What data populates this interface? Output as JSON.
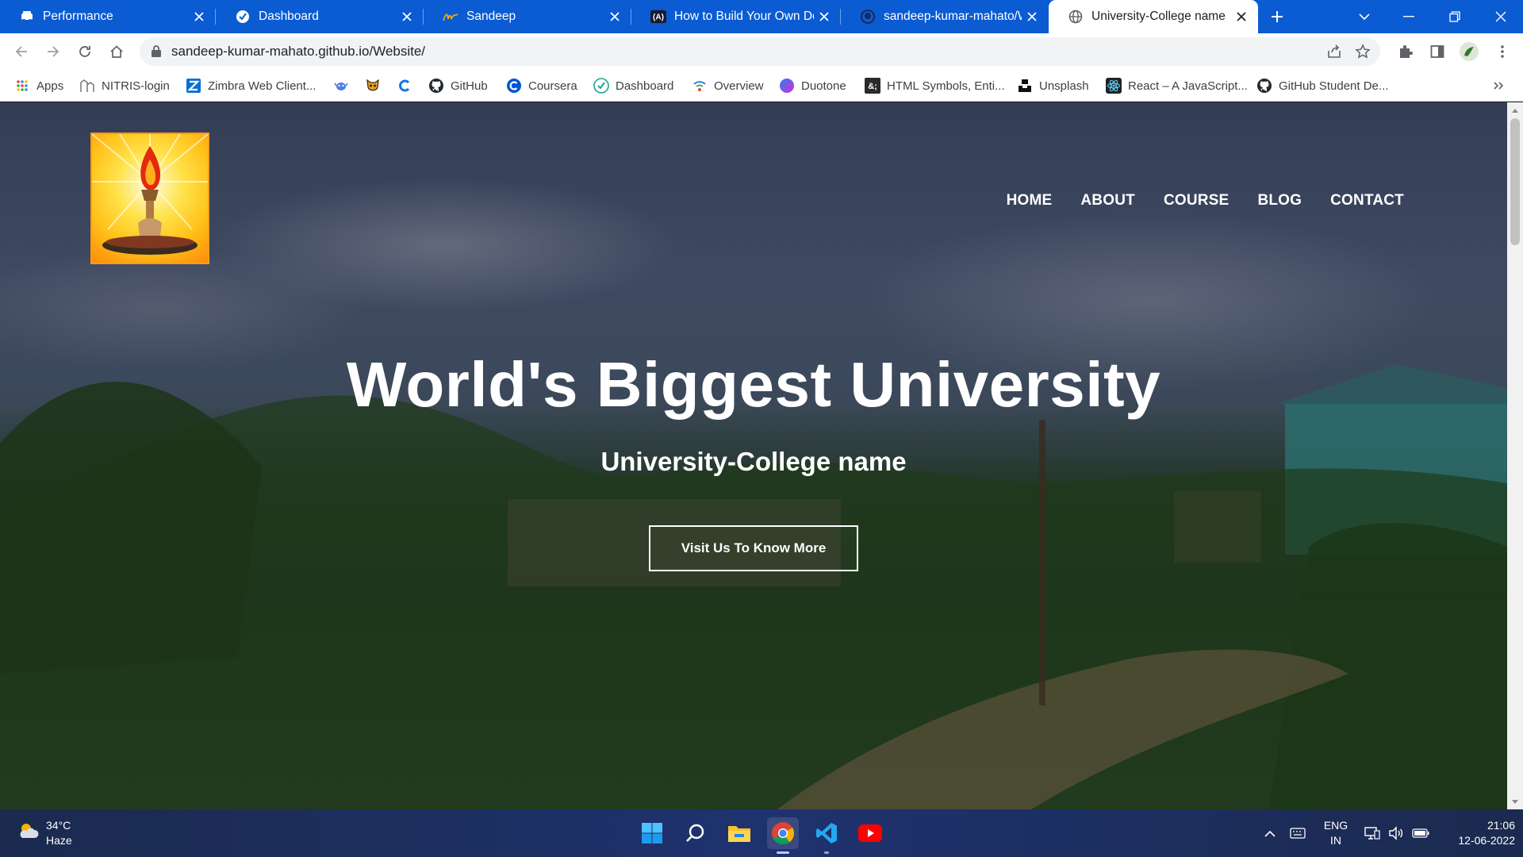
{
  "browser": {
    "tabs": [
      {
        "title": "Performance",
        "icon": "taxi-icon",
        "active": false
      },
      {
        "title": "Dashboard",
        "icon": "netlify-icon",
        "active": false
      },
      {
        "title": "Sandeep",
        "icon": "signature-icon",
        "active": false
      },
      {
        "title": "How to Build Your Own Dev",
        "icon": "a-icon",
        "active": false
      },
      {
        "title": "sandeep-kumar-mahato/W",
        "icon": "github-icon",
        "active": false
      },
      {
        "title": "University-College name",
        "icon": "globe-icon",
        "active": true
      }
    ],
    "url": "sandeep-kumar-mahato.github.io/Website/",
    "bookmarks": [
      {
        "label": "Apps",
        "icon": "apps-grid-icon"
      },
      {
        "label": "NITRIS-login",
        "icon": "nitris-icon"
      },
      {
        "label": "Zimbra Web Client...",
        "icon": "zimbra-icon"
      },
      {
        "label": "",
        "icon": "crab-icon"
      },
      {
        "label": "",
        "icon": "mask-icon"
      },
      {
        "label": "",
        "icon": "codechef-icon"
      },
      {
        "label": "GitHub",
        "icon": "github-icon"
      },
      {
        "label": "Coursera",
        "icon": "coursera-icon"
      },
      {
        "label": "Dashboard",
        "icon": "netlify-icon"
      },
      {
        "label": "Overview",
        "icon": "overview-icon"
      },
      {
        "label": "Duotone",
        "icon": "duotone-icon"
      },
      {
        "label": "HTML Symbols, Enti...",
        "icon": "html-symbols-icon"
      },
      {
        "label": "Unsplash",
        "icon": "unsplash-icon"
      },
      {
        "label": "React – A JavaScript...",
        "icon": "react-icon"
      },
      {
        "label": "GitHub Student De...",
        "icon": "github-icon"
      }
    ]
  },
  "page": {
    "nav": [
      "HOME",
      "ABOUT",
      "COURSE",
      "BLOG",
      "CONTACT"
    ],
    "hero_title": "World's Biggest University",
    "hero_subtitle": "University-College name",
    "cta_label": "Visit Us To Know More"
  },
  "taskbar": {
    "weather_temp": "34°C",
    "weather_desc": "Haze",
    "lang_line1": "ENG",
    "lang_line2": "IN",
    "time": "21:06",
    "date": "12-06-2022"
  },
  "colors": {
    "tabstrip": "#0b5bd3",
    "cta_border": "#ffffff",
    "logo_border": "#ff9c1a"
  }
}
